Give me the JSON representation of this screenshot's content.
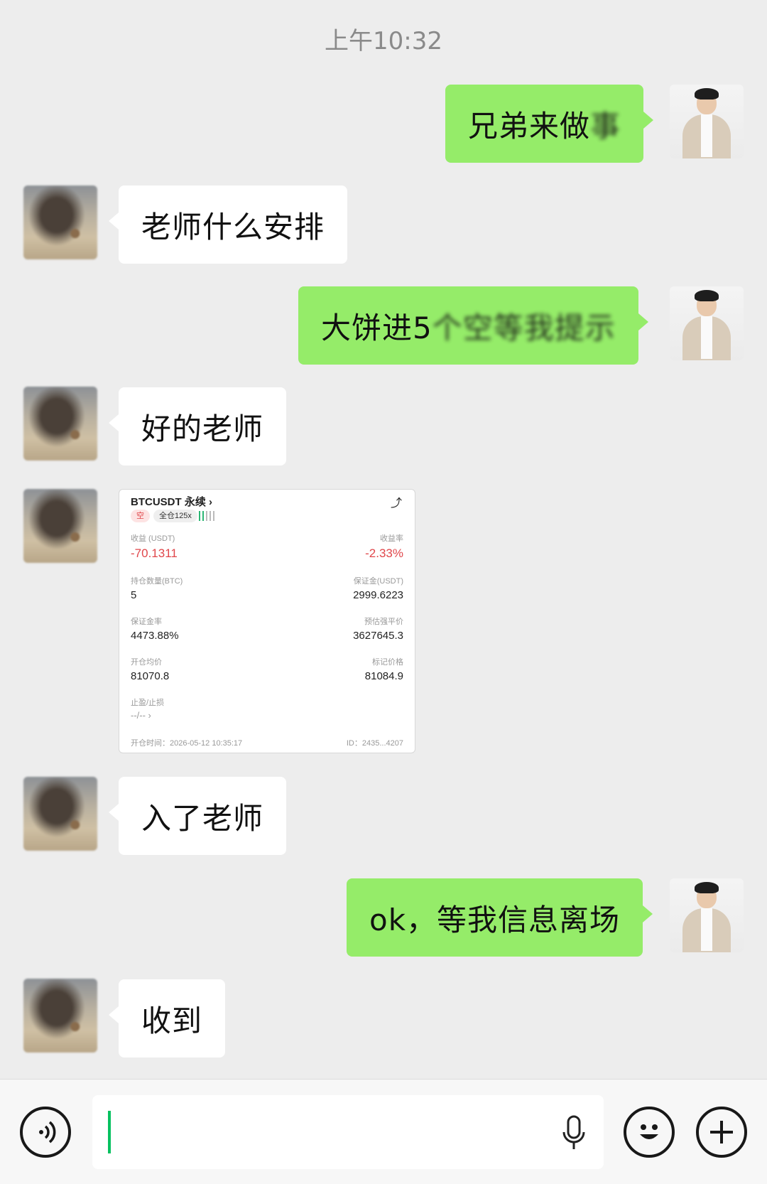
{
  "timestamp": "上午10:32",
  "messages": [
    {
      "from": "me",
      "text": "兄弟来做",
      "blurred": "事"
    },
    {
      "from": "them",
      "text": "老师什么安排"
    },
    {
      "from": "me",
      "text": "大饼进5",
      "blurred": "个空等我提示"
    },
    {
      "from": "them",
      "text": "好的老师"
    },
    {
      "from": "them",
      "type": "image"
    },
    {
      "from": "them",
      "text": "入了老师"
    },
    {
      "from": "me",
      "text": "ok，等我信息离场"
    },
    {
      "from": "them",
      "text": "收到"
    }
  ],
  "trade_card": {
    "title": "BTCUSDT 永续 ›",
    "side_tag": "空",
    "leverage_tag": "全仓125x",
    "pnl_label": "收益 (USDT)",
    "pnl_value": "-70.1311",
    "roe_label": "收益率",
    "roe_value": "-2.33%",
    "qty_label": "持仓数量(BTC)",
    "qty_value": "5",
    "margin_label": "保证金(USDT)",
    "margin_value": "2999.6223",
    "margin_ratio_label": "保证金率",
    "margin_ratio_value": "4473.88%",
    "liq_label": "预估强平价",
    "liq_value": "3627645.3",
    "entry_label": "开仓均价",
    "entry_value": "81070.8",
    "mark_label": "标记价格",
    "mark_value": "81084.9",
    "tpsl_label": "止盈/止损",
    "tpsl_value": "--/-- ›",
    "open_time": "开仓时间：2026-05-12 10:35:17",
    "id": "ID：2435...4207"
  },
  "colors": {
    "my_bubble": "#95ec69",
    "their_bubble": "#ffffff",
    "background": "#ededed",
    "loss_red": "#e0464a",
    "cursor_green": "#07c160"
  },
  "input_bar": {
    "left_icon": "voice-icon",
    "mic_icon": "microphone-icon",
    "emoji_icon": "emoji-icon",
    "plus_icon": "plus-icon"
  }
}
